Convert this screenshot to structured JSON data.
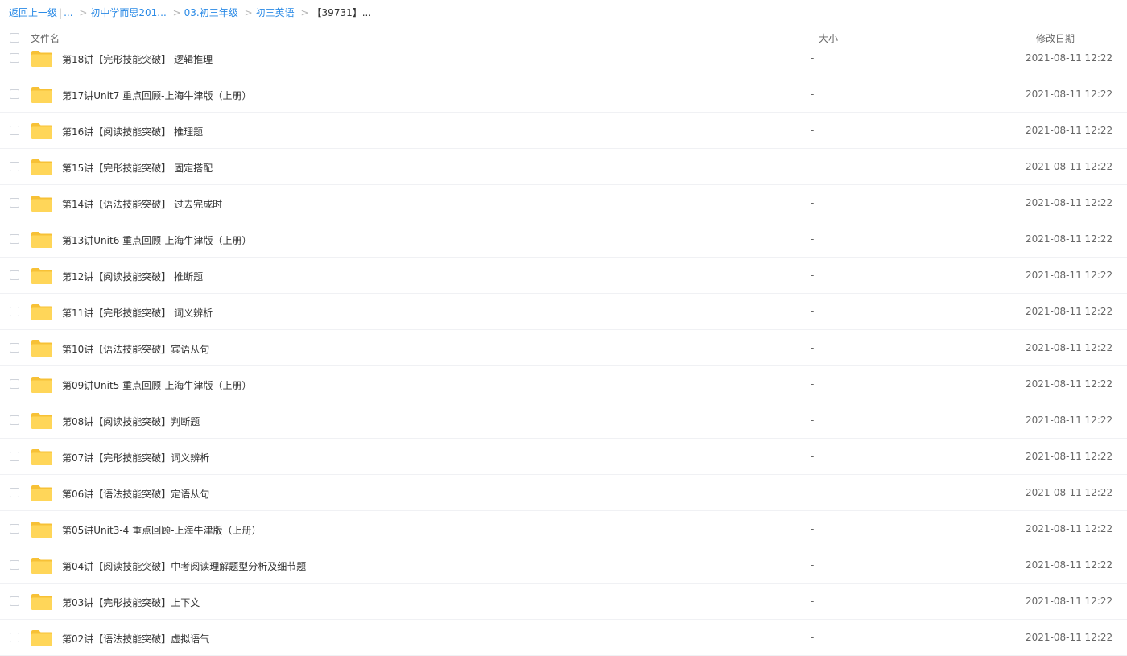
{
  "breadcrumb": {
    "back": "返回上一级",
    "ellipsis": "...",
    "crumbs": [
      "初中学而思201...",
      "03.初三年级",
      "初三英语"
    ],
    "current": "【39731】..."
  },
  "header": {
    "name": "文件名",
    "size": "大小",
    "date": "修改日期"
  },
  "colors": {
    "folder": "#ffd04b",
    "link": "#2a8ae6"
  },
  "icons": {
    "folder": "folder-icon"
  },
  "files": [
    {
      "name": "第18讲【完形技能突破】 逻辑推理",
      "size": "-",
      "date": "2021-08-11 12:22"
    },
    {
      "name": "第17讲Unit7 重点回顾-上海牛津版（上册）",
      "size": "-",
      "date": "2021-08-11 12:22"
    },
    {
      "name": "第16讲【阅读技能突破】 推理题",
      "size": "-",
      "date": "2021-08-11 12:22"
    },
    {
      "name": "第15讲【完形技能突破】 固定搭配",
      "size": "-",
      "date": "2021-08-11 12:22"
    },
    {
      "name": "第14讲【语法技能突破】 过去完成时",
      "size": "-",
      "date": "2021-08-11 12:22"
    },
    {
      "name": "第13讲Unit6 重点回顾-上海牛津版（上册）",
      "size": "-",
      "date": "2021-08-11 12:22"
    },
    {
      "name": "第12讲【阅读技能突破】 推断题",
      "size": "-",
      "date": "2021-08-11 12:22"
    },
    {
      "name": "第11讲【完形技能突破】 词义辨析",
      "size": "-",
      "date": "2021-08-11 12:22"
    },
    {
      "name": "第10讲【语法技能突破】宾语从句",
      "size": "-",
      "date": "2021-08-11 12:22"
    },
    {
      "name": "第09讲Unit5 重点回顾-上海牛津版（上册）",
      "size": "-",
      "date": "2021-08-11 12:22"
    },
    {
      "name": "第08讲【阅读技能突破】判断题",
      "size": "-",
      "date": "2021-08-11 12:22"
    },
    {
      "name": "第07讲【完形技能突破】词义辨析",
      "size": "-",
      "date": "2021-08-11 12:22"
    },
    {
      "name": "第06讲【语法技能突破】定语从句",
      "size": "-",
      "date": "2021-08-11 12:22"
    },
    {
      "name": "第05讲Unit3-4 重点回顾-上海牛津版（上册）",
      "size": "-",
      "date": "2021-08-11 12:22"
    },
    {
      "name": "第04讲【阅读技能突破】中考阅读理解题型分析及细节题",
      "size": "-",
      "date": "2021-08-11 12:22"
    },
    {
      "name": "第03讲【完形技能突破】上下文",
      "size": "-",
      "date": "2021-08-11 12:22"
    },
    {
      "name": "第02讲【语法技能突破】虚拟语气",
      "size": "-",
      "date": "2021-08-11 12:22"
    }
  ]
}
